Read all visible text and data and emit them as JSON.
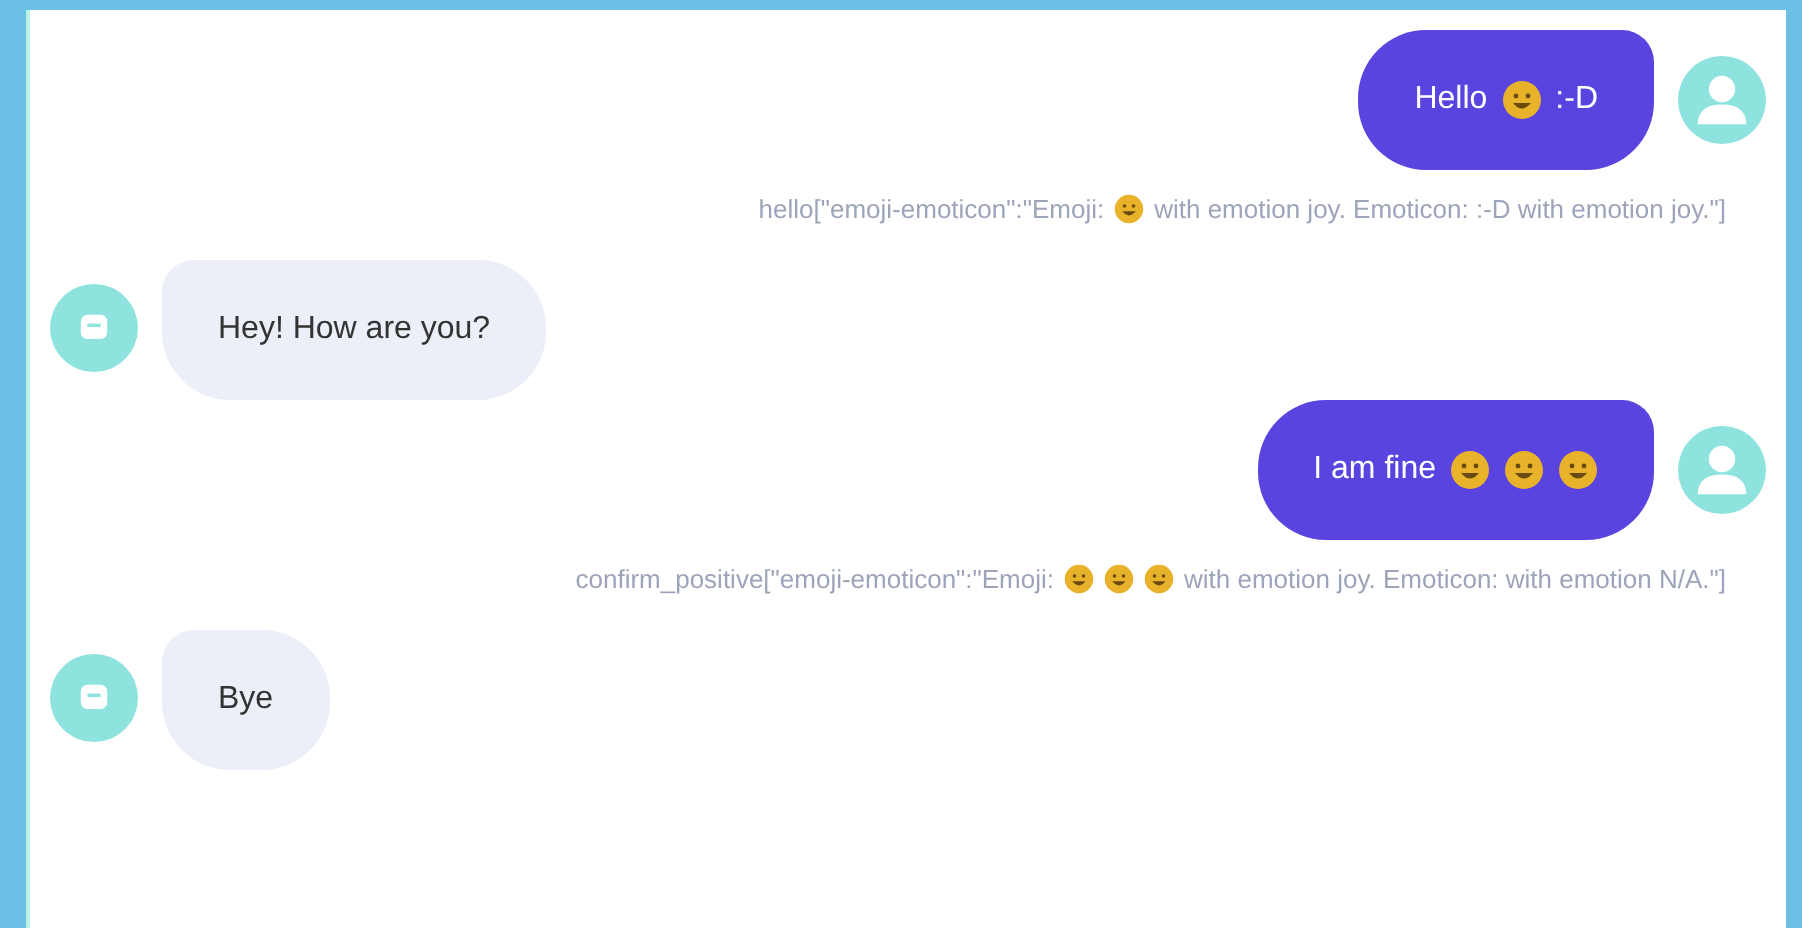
{
  "messages": [
    {
      "kind": "user",
      "parts": [
        {
          "kind": "text",
          "text": "Hello"
        },
        {
          "kind": "emoji"
        },
        {
          "kind": "text",
          "text": ":-D"
        }
      ]
    },
    {
      "kind": "annotation",
      "parts": [
        {
          "kind": "text",
          "text": "hello[\"emoji-emoticon\":\"Emoji:"
        },
        {
          "kind": "emoji"
        },
        {
          "kind": "text",
          "text": "with emotion joy. Emoticon: :-D with emotion joy.\"]"
        }
      ]
    },
    {
      "kind": "bot",
      "parts": [
        {
          "kind": "text",
          "text": "Hey! How are you?"
        }
      ]
    },
    {
      "kind": "user",
      "parts": [
        {
          "kind": "text",
          "text": "I am fine"
        },
        {
          "kind": "emoji"
        },
        {
          "kind": "emoji"
        },
        {
          "kind": "emoji"
        }
      ]
    },
    {
      "kind": "annotation",
      "parts": [
        {
          "kind": "text",
          "text": "confirm_positive[\"emoji-emoticon\":\"Emoji:"
        },
        {
          "kind": "emoji"
        },
        {
          "kind": "emoji"
        },
        {
          "kind": "emoji"
        },
        {
          "kind": "text",
          "text": "with emotion joy. Emoticon: with emotion N/A.\"]"
        }
      ]
    },
    {
      "kind": "bot",
      "parts": [
        {
          "kind": "text",
          "text": "Bye"
        }
      ]
    }
  ]
}
